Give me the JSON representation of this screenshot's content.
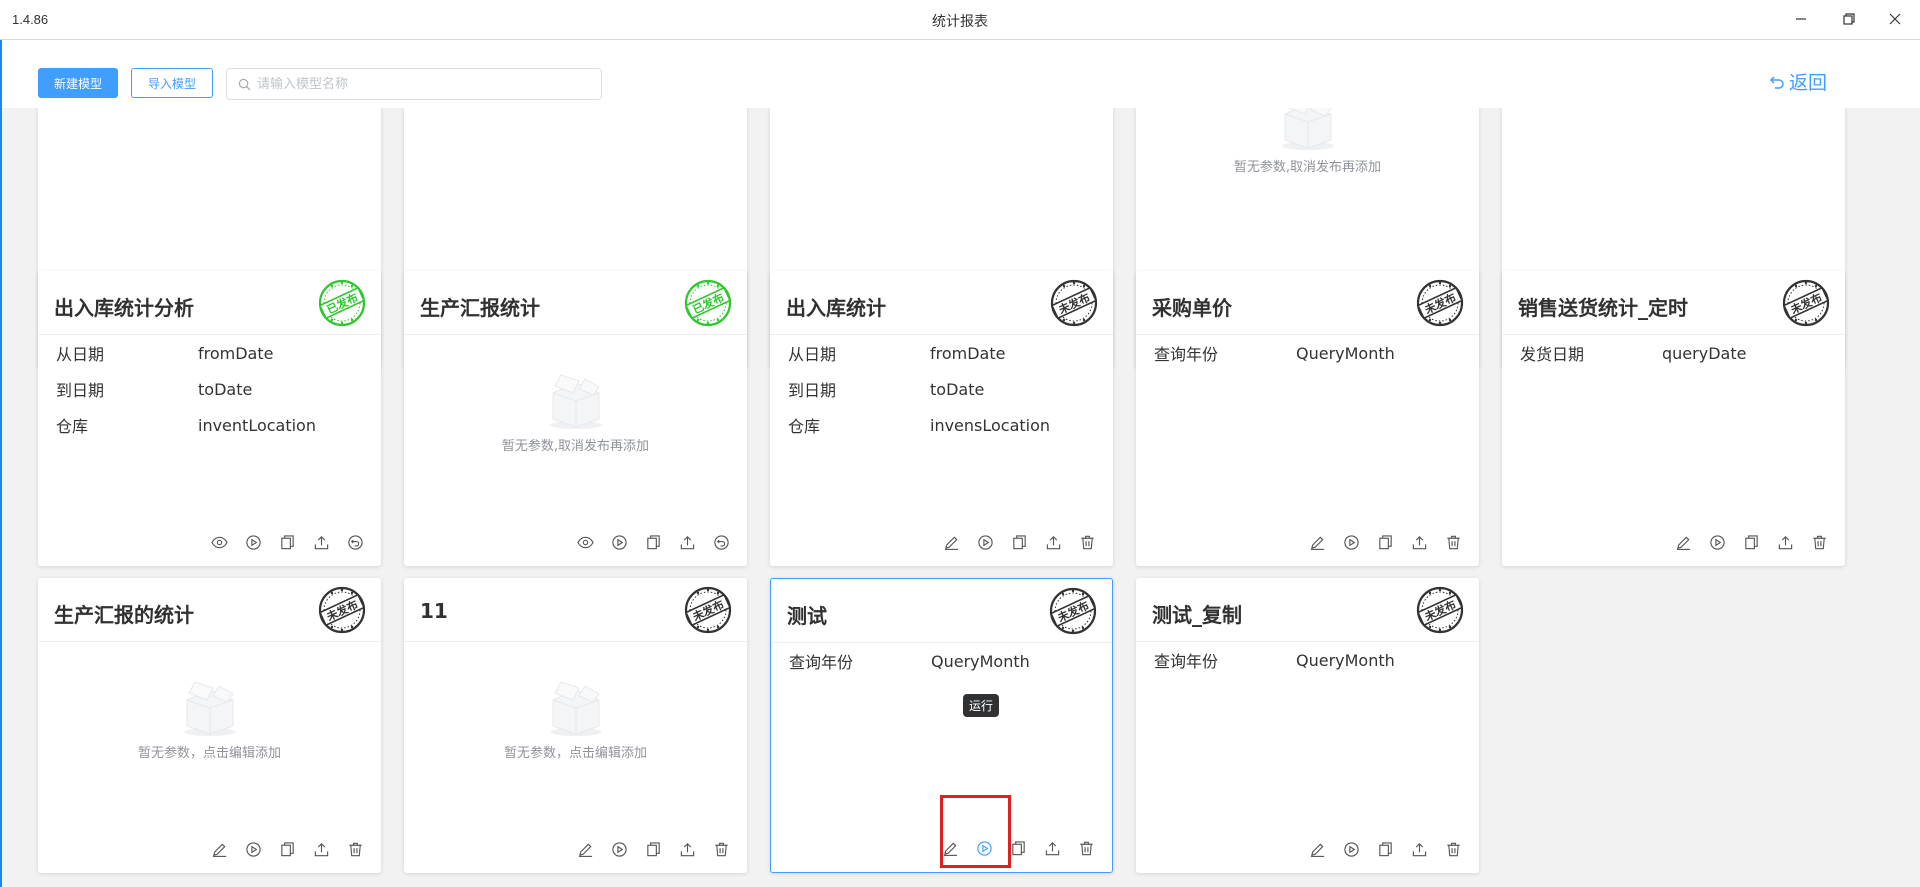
{
  "window": {
    "version": "1.4.86",
    "title": "统计报表"
  },
  "toolbar": {
    "new_label": "新建模型",
    "import_label": "导入模型",
    "search_placeholder": "请输入模型名称",
    "back_label": "返回"
  },
  "stamps": {
    "published": "已发布",
    "unpublished": "未发布"
  },
  "colors": {
    "accent": "#409eff",
    "published": "#2ec72e",
    "unpublished": "#333333",
    "highlight": "#e02020"
  },
  "tooltip": "运行",
  "cards_top": [
    {
      "empty_text": "",
      "actions": [
        "eye-icon",
        "play-icon",
        "copy-icon",
        "upload-icon",
        "revoke-icon"
      ]
    },
    {
      "empty_text": "",
      "actions": [
        "edit-icon",
        "play-icon",
        "copy-icon",
        "upload-icon",
        "delete-icon"
      ]
    },
    {
      "empty_text": "",
      "actions": [
        "eye-icon",
        "play-icon",
        "copy-icon",
        "upload-icon",
        "revoke-icon"
      ]
    },
    {
      "empty_text": "暂无参数,取消发布再添加",
      "actions": [
        "eye-icon",
        "play-icon",
        "copy-icon",
        "upload-icon",
        "revoke-icon"
      ]
    },
    {
      "empty_text": "",
      "actions": [
        "eye-icon",
        "play-icon",
        "copy-icon",
        "upload-icon",
        "revoke-icon"
      ]
    }
  ],
  "cards_mid": [
    {
      "title": "出入库统计分析",
      "status": "published",
      "params": [
        {
          "k": "从日期",
          "v": "fromDate"
        },
        {
          "k": "到日期",
          "v": "toDate"
        },
        {
          "k": "仓库",
          "v": "inventLocation"
        }
      ],
      "empty_text": "",
      "actions": [
        "eye-icon",
        "play-icon",
        "copy-icon",
        "upload-icon",
        "revoke-icon"
      ]
    },
    {
      "title": "生产汇报统计",
      "status": "published",
      "params": [],
      "empty_text": "暂无参数,取消发布再添加",
      "actions": [
        "eye-icon",
        "play-icon",
        "copy-icon",
        "upload-icon",
        "revoke-icon"
      ]
    },
    {
      "title": "出入库统计",
      "status": "unpublished",
      "params": [
        {
          "k": "从日期",
          "v": "fromDate"
        },
        {
          "k": "到日期",
          "v": "toDate"
        },
        {
          "k": "仓库",
          "v": "invensLocation"
        }
      ],
      "empty_text": "",
      "actions": [
        "edit-icon",
        "play-icon",
        "copy-icon",
        "upload-icon",
        "delete-icon"
      ]
    },
    {
      "title": "采购单价",
      "status": "unpublished",
      "params": [
        {
          "k": "查询年份",
          "v": "QueryMonth"
        }
      ],
      "empty_text": "",
      "actions": [
        "edit-icon",
        "play-icon",
        "copy-icon",
        "upload-icon",
        "delete-icon"
      ]
    },
    {
      "title": "销售送货统计_定时",
      "status": "unpublished",
      "params": [
        {
          "k": "发货日期",
          "v": "queryDate"
        }
      ],
      "empty_text": "",
      "actions": [
        "edit-icon",
        "play-icon",
        "copy-icon",
        "upload-icon",
        "delete-icon"
      ]
    }
  ],
  "cards_bottom": [
    {
      "title": "生产汇报的统计",
      "status": "unpublished",
      "params": [],
      "empty_text": "暂无参数，点击编辑添加",
      "actions": [
        "edit-icon",
        "play-icon",
        "copy-icon",
        "upload-icon",
        "delete-icon"
      ]
    },
    {
      "title": "11",
      "status": "unpublished",
      "params": [],
      "empty_text": "暂无参数，点击编辑添加",
      "actions": [
        "edit-icon",
        "play-icon",
        "copy-icon",
        "upload-icon",
        "delete-icon"
      ]
    },
    {
      "title": "测试",
      "status": "unpublished",
      "params": [
        {
          "k": "查询年份",
          "v": "QueryMonth"
        }
      ],
      "empty_text": "",
      "actions": [
        "edit-icon",
        "play-icon",
        "copy-icon",
        "upload-icon",
        "delete-icon"
      ]
    },
    {
      "title": "测试_复制",
      "status": "unpublished",
      "params": [
        {
          "k": "查询年份",
          "v": "QueryMonth"
        }
      ],
      "empty_text": "",
      "actions": [
        "edit-icon",
        "play-icon",
        "copy-icon",
        "upload-icon",
        "delete-icon"
      ]
    }
  ]
}
